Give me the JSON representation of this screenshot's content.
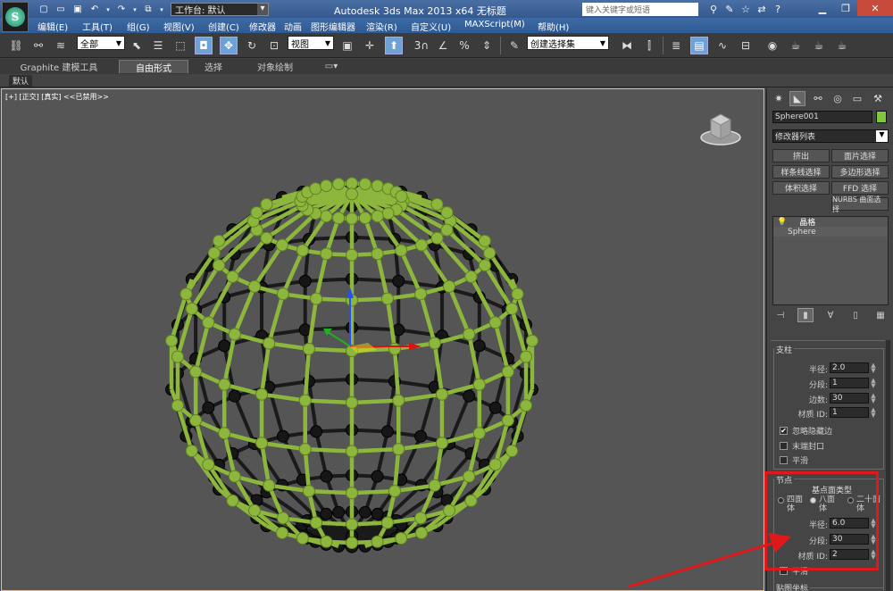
{
  "titlebar": {
    "workspace_label": "工作台: 默认",
    "title": "Autodesk 3ds Max  2013 x64     无标题",
    "search_placeholder": "键入关键字或短语"
  },
  "menu": {
    "items": [
      "编辑(E)",
      "工具(T)",
      "组(G)",
      "视图(V)",
      "创建(C)",
      "修改器",
      "动画",
      "图形编辑器",
      "渲染(R)",
      "自定义(U)",
      "MAXScript(M)",
      "帮助(H)"
    ]
  },
  "toolbar": {
    "selection_filter": "全部",
    "reference_coord": "视图",
    "named_selection": "创建选择集",
    "snap_label": "3"
  },
  "ribbon": {
    "tabs": [
      "Graphite 建模工具",
      "自由形式",
      "选择",
      "对象绘制"
    ],
    "active_tab": "自由形式",
    "sub_label": "默认"
  },
  "viewport": {
    "label": "[+] [正交] [真实]  <<已禁用>>"
  },
  "command_panel": {
    "object_name": "Sphere001",
    "object_color": "#7ec83c",
    "modifier_list": "修改器列表",
    "buttons": [
      "挤出",
      "面片选择",
      "样条线选择",
      "多边形选择",
      "体积选择",
      "FFD 选择",
      "NURBS 曲面选择"
    ],
    "stack": [
      "晶格",
      "Sphere"
    ],
    "struts": {
      "title": "支柱",
      "radius_label": "半径:",
      "radius": "2.0",
      "segments_label": "分段:",
      "segments": "1",
      "sides_label": "边数:",
      "sides": "30",
      "matid_label": "材质 ID:",
      "matid": "1",
      "ignore_hidden": "忽略隐藏边",
      "end_caps": "末端封口",
      "smooth": "平滑"
    },
    "joints": {
      "title": "节点",
      "geodesic_label": "基点面类型",
      "tetra": "四面体",
      "octa": "八面体",
      "icosa": "二十面体",
      "radius_label": "半径:",
      "radius": "6.0",
      "segments_label": "分段:",
      "segments": "30",
      "matid_label": "材质 ID:",
      "matid": "2",
      "smooth": "平滑"
    },
    "mapping_title": "贴图坐标"
  },
  "colors": {
    "lattice": "#8db63c",
    "annotation": "#e0181a"
  }
}
